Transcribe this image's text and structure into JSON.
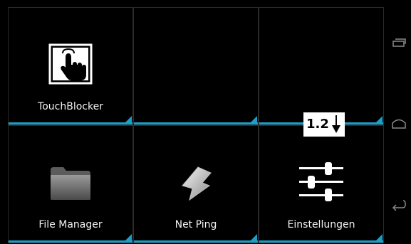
{
  "tiles": [
    {
      "id": "touchblocker",
      "label": "TouchBlocker",
      "icon": "touch-hand-icon"
    },
    {
      "id": "empty-1",
      "label": "",
      "icon": ""
    },
    {
      "id": "empty-2",
      "label": "",
      "icon": ""
    },
    {
      "id": "file-manager",
      "label": "File Manager",
      "icon": "folder-icon"
    },
    {
      "id": "net-ping",
      "label": "Net Ping",
      "icon": "lightning-icon"
    },
    {
      "id": "einstellungen",
      "label": "Einstellungen",
      "icon": "sliders-icon"
    }
  ],
  "version_badge": {
    "text": "1.2"
  },
  "navbar": {
    "buttons": [
      "recent-apps-icon",
      "home-icon",
      "back-icon"
    ]
  },
  "colors": {
    "accent": "#1a9fc8",
    "background": "#000000",
    "text": "#f2f2f2"
  }
}
